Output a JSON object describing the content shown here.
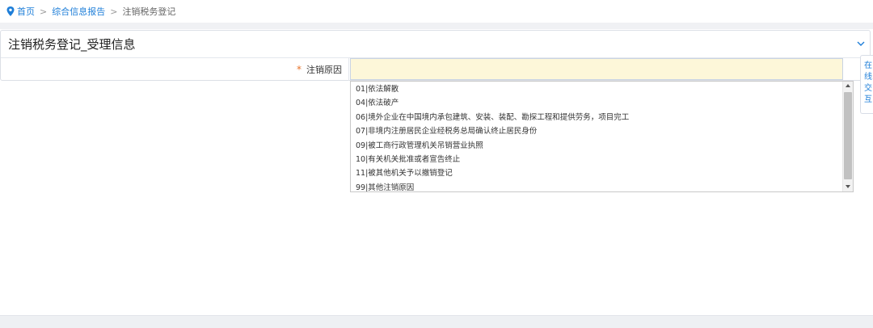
{
  "breadcrumb": {
    "home": "首页",
    "separator": ">",
    "level2": "综合信息报告",
    "current": "注销税务登记"
  },
  "panel": {
    "title": "注销税务登记_受理信息"
  },
  "form": {
    "required_mark": "*",
    "reason_label": "注销原因",
    "reason_value": ""
  },
  "dropdown": {
    "options": [
      "01|依法解散",
      "04|依法破产",
      "06|境外企业在中国境内承包建筑、安装、装配、勘探工程和提供劳务，项目完工",
      "07|非境内注册居民企业经税务总局确认终止居民身份",
      "09|被工商行政管理机关吊销营业执照",
      "10|有关机关批准或者宣告终止",
      "11|被其他机关予以撤销登记",
      "99|其他注销原因"
    ]
  },
  "side_panel": {
    "chars": [
      "在",
      "线",
      "交",
      "互"
    ]
  },
  "colors": {
    "link": "#1e7ed8",
    "required": "#e8732b",
    "input_bg": "#fdf7d9"
  }
}
